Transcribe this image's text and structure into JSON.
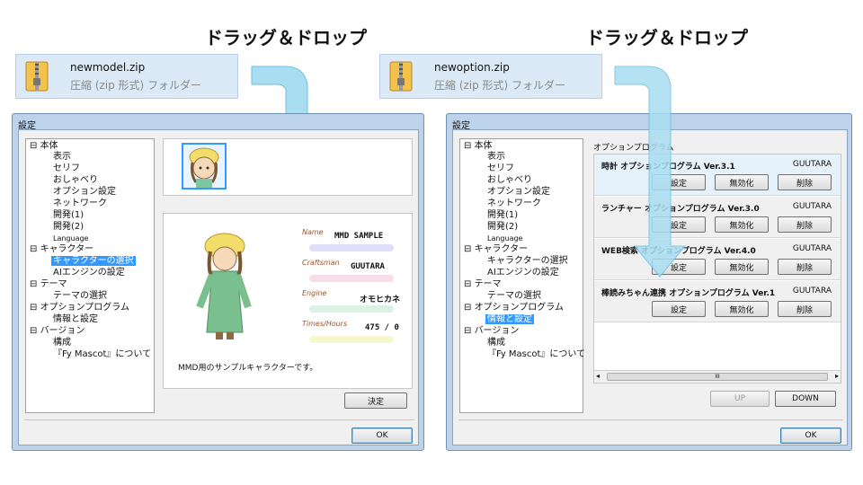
{
  "left": {
    "caption": "ドラッグ＆ドロップ",
    "file": {
      "name": "newmodel.zip",
      "type": "圧縮 (zip 形式) フォルダー"
    },
    "dialog": {
      "title": "設定",
      "tree": [
        "本体",
        "表示",
        "セリフ",
        "おしゃべり",
        "オプション設定",
        "ネットワーク",
        "開発(1)",
        "開発(2)",
        "Language",
        "キャラクター",
        "キャラクターの選択",
        "AIエンジンの設定",
        "テーマ",
        "テーマの選択",
        "オプションプログラム",
        "情報と設定",
        "バージョン",
        "構成",
        "『Fy Mascot』について"
      ],
      "fields": [
        {
          "label": "Name",
          "value": "MMD SAMPLE"
        },
        {
          "label": "Craftsman",
          "value": "GUUTARA"
        },
        {
          "label": "Engine",
          "value": "オモヒカネ"
        },
        {
          "label": "Times/Hours",
          "value": "475 / 0"
        }
      ],
      "description": "MMD用のサンプルキャラクターです。",
      "decide_label": "決定",
      "ok_label": "OK"
    }
  },
  "right": {
    "caption": "ドラッグ＆ドロップ",
    "file": {
      "name": "newoption.zip",
      "type": "圧縮 (zip 形式) フォルダー"
    },
    "dialog": {
      "title": "設定",
      "tree": [
        "本体",
        "表示",
        "セリフ",
        "おしゃべり",
        "オプション設定",
        "ネットワーク",
        "開発(1)",
        "開発(2)",
        "Language",
        "キャラクター",
        "キャラクターの選択",
        "AIエンジンの設定",
        "テーマ",
        "テーマの選択",
        "オプションプログラム",
        "情報と設定",
        "バージョン",
        "構成",
        "『Fy Mascot』について"
      ],
      "section_title": "オプションプログラム",
      "plugins": [
        {
          "name": "時計 オプションプログラム Ver.3.1",
          "author": "GUUTARA"
        },
        {
          "name": "ランチャー オプションプログラム Ver.3.0",
          "author": "GUUTARA"
        },
        {
          "name": "WEB検索 オプションプログラム Ver.4.0",
          "author": "GUUTARA"
        },
        {
          "name": "棒読みちゃん連携 オプションプログラム Ver.1",
          "author": "GUUTARA"
        }
      ],
      "settings_label": "設定",
      "disable_label": "無効化",
      "delete_label": "削除",
      "up_label": "UP",
      "down_label": "DOWN",
      "ok_label": "OK",
      "scroll_mark": "III"
    }
  },
  "colors": {
    "accent": "#3399ff",
    "arrow": "#8fd3ee",
    "window": "#bcd3ea"
  }
}
